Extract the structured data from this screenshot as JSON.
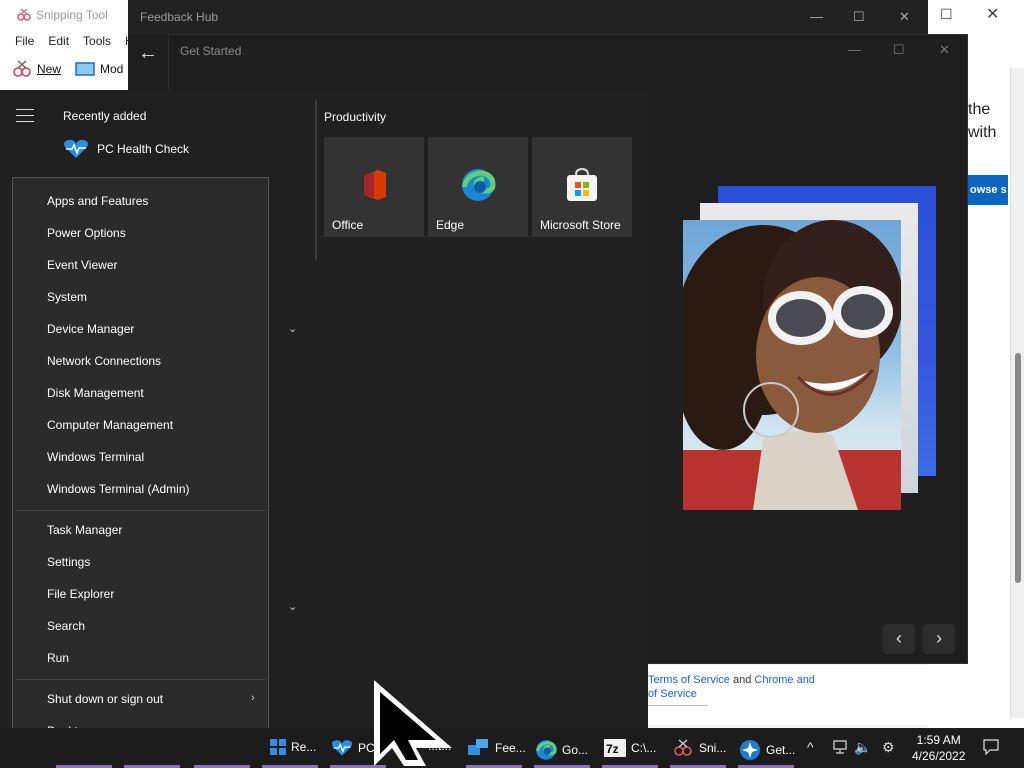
{
  "snipping_tool": {
    "title": "Snipping Tool",
    "menu": [
      "File",
      "Edit",
      "Tools",
      "H"
    ],
    "new_label": "New",
    "mode_label": "Mod"
  },
  "feedback_hub": {
    "title": "Feedback Hub"
  },
  "get_started": {
    "title": "Get Started"
  },
  "browser": {
    "text_lines": [
      "the",
      "with"
    ],
    "button_label": "owse s",
    "terms": {
      "link1": "Terms of Service",
      "and_text": " and ",
      "link2": "Chrome and",
      "link3": "of Service"
    }
  },
  "start_menu": {
    "recently_added_heading": "Recently added",
    "recent_apps": [
      {
        "name": "PC Health Check",
        "icon": "heart-pulse-icon"
      }
    ],
    "productivity_heading": "Productivity",
    "tiles": [
      {
        "label": "Office",
        "icon": "office-icon"
      },
      {
        "label": "Edge",
        "icon": "edge-icon"
      },
      {
        "label": "Microsoft Store",
        "icon": "store-icon"
      }
    ]
  },
  "context_menu": {
    "group1": [
      "Apps and Features",
      "Power Options",
      "Event Viewer",
      "System",
      "Device Manager",
      "Network Connections",
      "Disk Management",
      "Computer Management",
      "Windows Terminal",
      "Windows Terminal (Admin)"
    ],
    "group2": [
      "Task Manager",
      "Settings",
      "File Explorer",
      "Search",
      "Run"
    ],
    "group3": [
      "Shut down or sign out",
      "Desktop"
    ]
  },
  "taskbar": {
    "apps": [
      {
        "label": "Re...",
        "icon": "windows-app-icon"
      },
      {
        "label": "PC",
        "icon": "heart-pulse-icon"
      },
      {
        "label": "...t...",
        "icon": "app-icon"
      },
      {
        "label": "Fee...",
        "icon": "feedback-icon"
      },
      {
        "label": "Go...",
        "icon": "edge-icon"
      },
      {
        "label": "C:\\...",
        "icon": "7zip-icon"
      },
      {
        "label": "Sni...",
        "icon": "snipping-icon"
      },
      {
        "label": "Get...",
        "icon": "get-started-icon"
      }
    ],
    "time": "1:59 AM",
    "date": "4/26/2022"
  },
  "colors": {
    "accent": "#8b6fb8",
    "link": "#1a62d6",
    "dark_bg": "#202020",
    "menu_bg": "#2b2b2b"
  }
}
